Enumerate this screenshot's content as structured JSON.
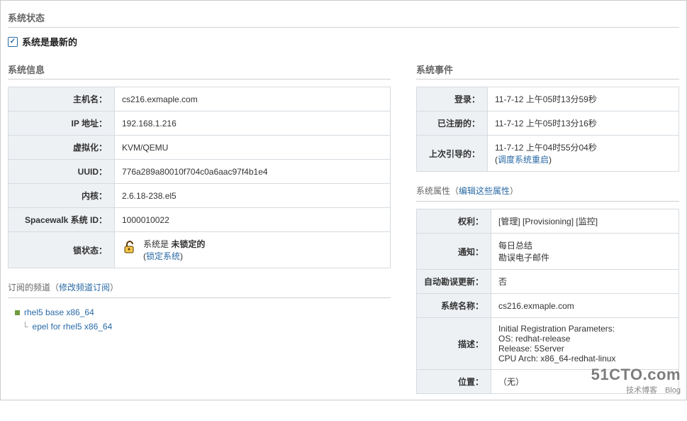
{
  "page_title": "系统状态",
  "status_text": "系统是最新的",
  "left": {
    "info_title": "系统信息",
    "rows": {
      "hostname_label": "主机名：",
      "hostname": "cs216.exmaple.com",
      "ip_label": "IP 地址：",
      "ip": "192.168.1.216",
      "virt_label": "虚拟化：",
      "virt": "KVM/QEMU",
      "uuid_label": "UUID：",
      "uuid": "776a289a80010f704c0a6aac97f4b1e4",
      "kernel_label": "内核：",
      "kernel": "2.6.18-238.el5",
      "sysid_label": "Spacewalk 系统 ID：",
      "sysid": "1000010022",
      "lock_label": "锁状态：",
      "lock_prefix": "系统是 ",
      "lock_state": "未锁定的",
      "lock_link": "锁定系统"
    },
    "channels_header_prefix": "订阅的频道（",
    "channels_header_link": "修改频道订阅",
    "channels_header_suffix": "）",
    "channels": {
      "base": "rhel5 base x86_64",
      "child": "epel for rhel5 x86_64"
    }
  },
  "right": {
    "events_title": "系统事件",
    "events": {
      "login_label": "登录：",
      "login": "11-7-12 上午05时13分59秒",
      "reg_label": "已注册的：",
      "reg": "11-7-12 上午05时13分16秒",
      "boot_label": "上次引导的：",
      "boot": "11-7-12 上午04时55分04秒",
      "boot_link": "调度系统重启"
    },
    "props_header_prefix": "系统属性（",
    "props_header_link": "编辑这些属性",
    "props_header_suffix": "）",
    "props": {
      "entitle_label": "权利：",
      "entitle": "[管理] [Provisioning] [监控]",
      "notify_label": "通知：",
      "notify_line1": "每日总结",
      "notify_line2": "勘误电子邮件",
      "auto_label": "自动勘误更新：",
      "auto": "否",
      "sysname_label": "系统名称：",
      "sysname": "cs216.exmaple.com",
      "desc_label": "描述：",
      "desc_line1": "Initial Registration Parameters:",
      "desc_line2": "OS: redhat-release",
      "desc_line3": "Release: 5Server",
      "desc_line4": "CPU Arch: x86_64-redhat-linux",
      "loc_label": "位置：",
      "loc": "（无）"
    }
  },
  "watermark": {
    "brand": "51CTO.com",
    "sub": "技术博客　Blog"
  }
}
